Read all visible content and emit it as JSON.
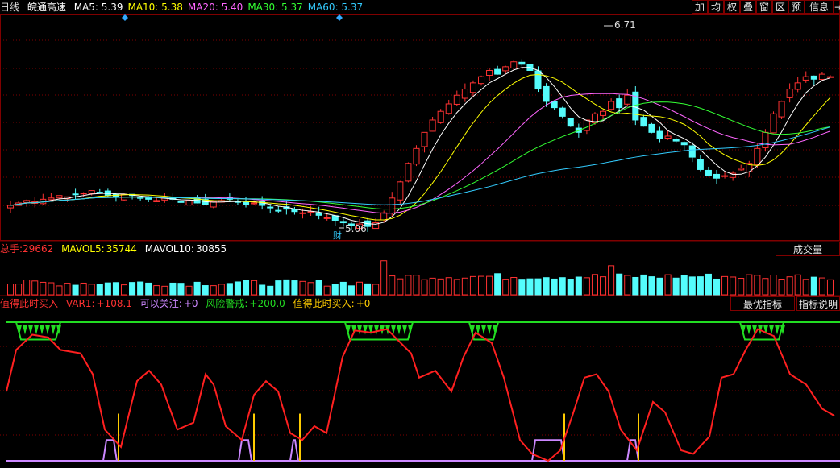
{
  "header": {
    "period": "日线",
    "stock_name": "皖通高速",
    "ma": [
      {
        "label": "MA5:",
        "value": "5.39",
        "color": "#ffffff"
      },
      {
        "label": "MA10:",
        "value": "5.38",
        "color": "#ffff00"
      },
      {
        "label": "MA20:",
        "value": "5.40",
        "color": "#ff66ff"
      },
      {
        "label": "MA30:",
        "value": "5.37",
        "color": "#33ff33"
      },
      {
        "label": "MA60:",
        "value": "5.37",
        "color": "#33ccff"
      }
    ]
  },
  "toolbar": {
    "buttons": [
      {
        "label": "加",
        "name": "add-button"
      },
      {
        "label": "均",
        "name": "average-button"
      },
      {
        "label": "权",
        "name": "rights-button"
      },
      {
        "label": "叠",
        "name": "overlay-button"
      },
      {
        "label": "窗",
        "name": "window-button"
      },
      {
        "label": "区",
        "name": "range-button"
      },
      {
        "label": "预",
        "name": "forecast-button"
      },
      {
        "label": "信息",
        "name": "info-button"
      }
    ],
    "exit_icon": "exit-icon"
  },
  "price_annotations": {
    "high": "6.71",
    "low": "5.06",
    "finance_tag": "财"
  },
  "volume": {
    "label": "总手:",
    "value": "29662",
    "mavol5_label": "MAVOL5:",
    "mavol5": "35744",
    "mavol10_label": "MAVOL10:",
    "mavol10": "30855",
    "tab": "成交量"
  },
  "indicator": {
    "title": "值得此时买入",
    "var1_label": "VAR1:",
    "var1": "+108.1",
    "watch_label": "可以关注:",
    "watch": "+0",
    "risk_label": "风险警戒:",
    "risk": "+200.0",
    "buy_label": "值得此时买入:",
    "buy": "+0",
    "tab_best": "最优指标",
    "tab_help": "指标说明"
  },
  "colors": {
    "up": "#ff3232",
    "down": "#54fcfc",
    "grid": "#800000",
    "ma5": "#ffffff",
    "ma10": "#ffff00",
    "ma20": "#ff66ff",
    "ma30": "#33ff33",
    "ma60": "#33ccff",
    "var1": "#ff2020",
    "risk": "#22dd22",
    "watch": "#cc88ff",
    "buy": "#ffcc00"
  },
  "chart_data": {
    "type": "candlestick",
    "price_range": [
      5.0,
      6.75
    ],
    "close_series": [
      5.26,
      5.28,
      5.3,
      5.29,
      5.31,
      5.32,
      5.34,
      5.33,
      5.35,
      5.36,
      5.38,
      5.36,
      5.34,
      5.33,
      5.35,
      5.34,
      5.32,
      5.31,
      5.3,
      5.32,
      5.31,
      5.29,
      5.3,
      5.28,
      5.27,
      5.29,
      5.3,
      5.31,
      5.29,
      5.27,
      5.28,
      5.26,
      5.24,
      5.22,
      5.23,
      5.21,
      5.2,
      5.21,
      5.18,
      5.16,
      5.14,
      5.12,
      5.1,
      5.11,
      5.09,
      5.12,
      5.2,
      5.32,
      5.45,
      5.6,
      5.72,
      5.85,
      5.95,
      6.02,
      6.08,
      6.15,
      6.2,
      6.25,
      6.3,
      6.35,
      6.32,
      6.38,
      6.42,
      6.4,
      6.35,
      6.2,
      6.1,
      6.05,
      5.98,
      5.9,
      5.85,
      5.95,
      6.0,
      6.02,
      6.1,
      6.05,
      6.15,
      5.95,
      5.9,
      5.85,
      5.8,
      5.82,
      5.78,
      5.75,
      5.65,
      5.55,
      5.5,
      5.48,
      5.5,
      5.52,
      5.56,
      5.6,
      5.72,
      5.85,
      6.0,
      6.1,
      6.2,
      6.25,
      6.3,
      6.28,
      6.32,
      6.3
    ],
    "volume_scale_max": 90000,
    "indicator_range": [
      0,
      200
    ]
  }
}
